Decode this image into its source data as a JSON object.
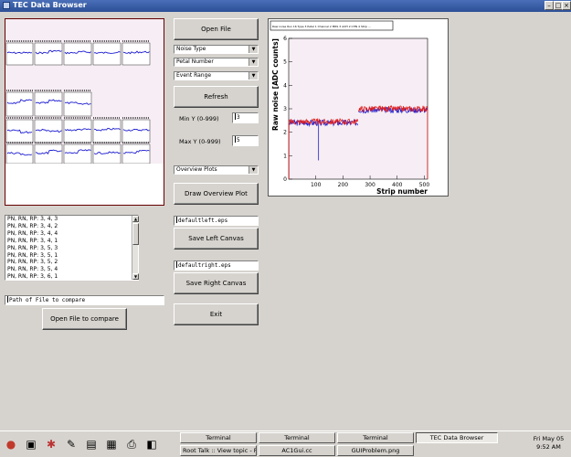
{
  "window": {
    "title": "TEC Data Browser",
    "controls": [
      "–",
      "□",
      "×"
    ]
  },
  "left_canvas": {
    "empty_label": ""
  },
  "right_canvas": {
    "chart_data": {
      "type": "line",
      "title": "Raw noise Run 16 Type 3 Petal 1 Channel 2 MRS 3 AOH 2 CHN 4 Strip ...",
      "xlabel": "Strip number",
      "ylabel": "Raw noise [ADC counts]",
      "xlim": [
        0,
        512
      ],
      "ylim": [
        0,
        6
      ],
      "xticks": [
        "100",
        "200",
        "300",
        "400",
        "500"
      ],
      "yticks": [
        "0",
        "1",
        "2",
        "3",
        "4",
        "5",
        "6"
      ],
      "series": [
        {
          "color": "#2020d0",
          "segments": [
            {
              "x": [
                1,
                256
              ],
              "y": 2.4
            },
            {
              "x": 257,
              "dip": 0.8,
              "at": 110
            },
            {
              "x": [
                257,
                512
              ],
              "y": 2.95
            }
          ]
        },
        {
          "color": "#e02020",
          "segments": [
            {
              "x": [
                1,
                256
              ],
              "y": 2.45
            },
            {
              "x": [
                257,
                512
              ],
              "y": 3.0
            }
          ]
        }
      ]
    }
  },
  "buttons": {
    "open_file": "Open File",
    "refresh": "Refresh",
    "draw_overview": "Draw Overview Plot",
    "save_left": "Save Left Canvas",
    "save_right": "Save Right Canvas",
    "exit": "Exit",
    "open_compare": "Open File to compare"
  },
  "combos": {
    "noise_type": "Noise Type",
    "petal_number": "Petal Number",
    "event_range": "Event Range",
    "overview_plots": "Overview Plots"
  },
  "ranges": {
    "min_label": "Min Y (0-999)",
    "min_value": "3",
    "max_label": "Max Y (0-999)",
    "max_value": "5"
  },
  "files": {
    "left_name": "defaultleft.eps",
    "right_name": "defaultright.eps",
    "compare_placeholder": "Path of File to compare"
  },
  "list_items": [
    "PN, RN, RP: 3, 4, 3",
    "PN, RN, RP: 3, 4, 2",
    "PN, RN, RP: 3, 4, 4",
    "PN, RN, RP: 3, 4, 1",
    "PN, RN, RP: 3, 5, 3",
    "PN, RN, RP: 3, 5, 1",
    "PN, RN, RP: 3, 5, 2",
    "PN, RN, RP: 3, 5, 4",
    "PN, RN, RP: 3, 6, 1"
  ],
  "taskbar": {
    "tasks_top": [
      "Terminal",
      "Terminal",
      "Terminal",
      "TEC Data Browser"
    ],
    "tasks_bottom": [
      "Root Talk :: View topic - F",
      "AC1Gui.cc",
      "GUIProblem.png"
    ],
    "clock_day": "Fri May 05",
    "clock_time": "9:52 AM"
  }
}
